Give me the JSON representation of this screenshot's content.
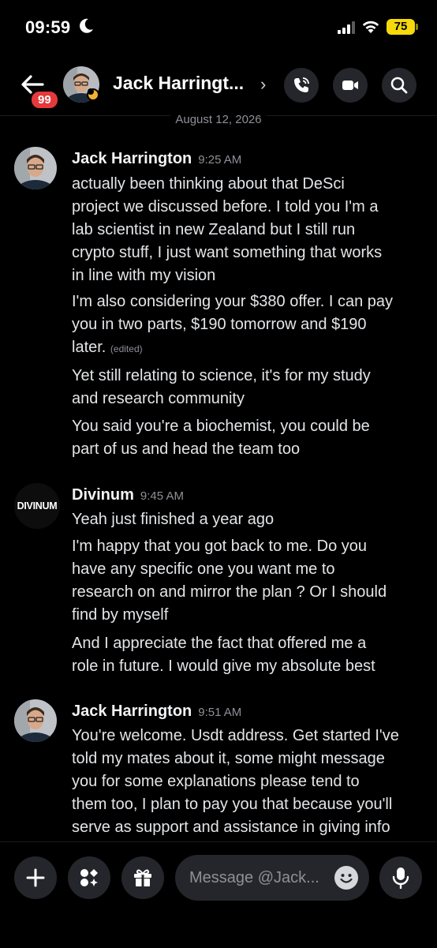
{
  "status": {
    "time": "09:59",
    "battery": "75"
  },
  "header": {
    "unread_badge": "99",
    "contact_name": "Jack Harringt...",
    "chevron": "›"
  },
  "date_divider": "August 12, 2026",
  "messages": [
    {
      "author": "Jack Harrington",
      "timestamp": "9:25 AM",
      "lines": [
        "actually been thinking about that DeSci",
        "project we discussed before. I told you I'm a",
        "lab scientist in new Zealand but I still run",
        "crypto stuff, I just want something that works",
        "in line with my vision",
        "I'm also considering your $380 offer. I can pay",
        "you in two parts, $190 tomorrow and $190",
        "later.",
        "Yet still relating to science, it's for my study",
        "and research community",
        "You said you're a biochemist, you could be",
        "part of us and head the team too"
      ],
      "edited_label": "(edited)"
    },
    {
      "author": "Divinum",
      "avatar_text": "DIVINUM",
      "timestamp": "9:45 AM",
      "lines": [
        "Yeah just finished a year ago",
        "I'm happy that you got back to me. Do you",
        "have any specific one you want me to",
        "research on and mirror the plan ? Or I should",
        "find by myself",
        "And I appreciate the fact that offered me a",
        "role in future. I would give my absolute best"
      ]
    },
    {
      "author": "Jack Harrington",
      "timestamp": "9:51 AM",
      "lines": [
        "You're welcome. Usdt address. Get started I've",
        "told my mates about it, some might message",
        "you for some explanations please tend to",
        "them too, I plan to pay you that because you'll",
        "serve as support and assistance in giving info"
      ]
    }
  ],
  "composer": {
    "placeholder": "Message @Jack..."
  },
  "icons": [
    "moon-icon",
    "signal-icon",
    "wifi-icon",
    "back-arrow-icon",
    "phone-call-icon",
    "video-icon",
    "search-icon",
    "plus-icon",
    "apps-icon",
    "gift-icon",
    "emoji-icon",
    "mic-icon"
  ]
}
